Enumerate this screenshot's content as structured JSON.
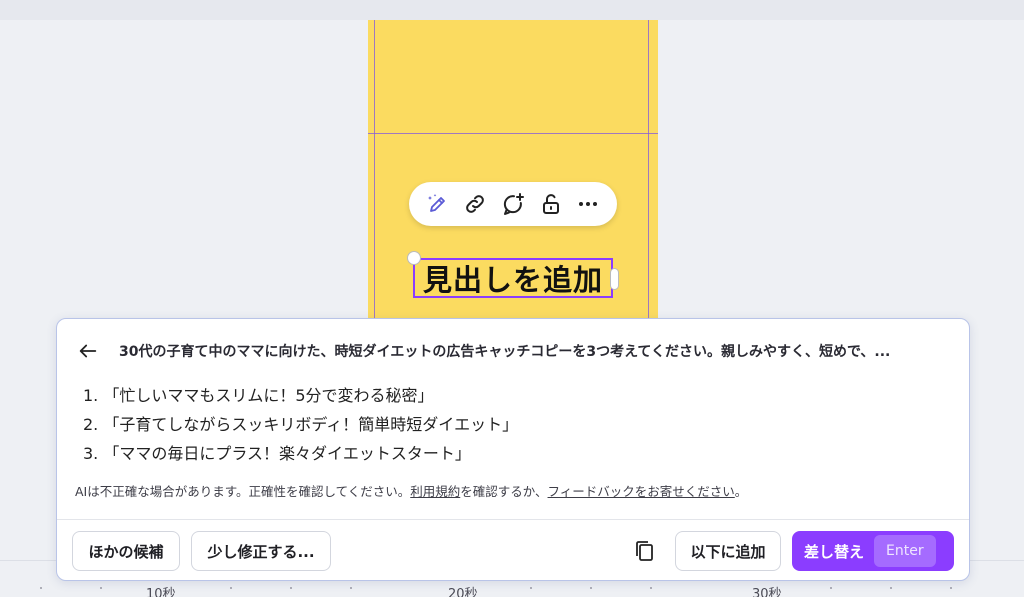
{
  "canvas": {
    "background_color": "#fbdb60",
    "guide_color": "#8a5fd6",
    "heading_text": "見出しを追加"
  },
  "floating_toolbar": {
    "items": [
      {
        "icon": "magic-pencil-icon"
      },
      {
        "icon": "link-icon"
      },
      {
        "icon": "add-comment-icon"
      },
      {
        "icon": "lock-icon"
      },
      {
        "icon": "more-icon"
      }
    ]
  },
  "ai_panel": {
    "back_icon": "arrow-left-icon",
    "prompt": "30代の子育て中のママに向けた、時短ダイエットの広告キャッチコピーを3つ考えてください。親しみやすく、短めで、...",
    "results": [
      "1. 「忙しいママもスリムに！5分で変わる秘密」",
      "2. 「子育てしながらスッキリボディ！簡単時短ダイエット」",
      "3. 「ママの毎日にプラス！楽々ダイエットスタート」"
    ],
    "disclaimer": {
      "text1": "AIは不正確な場合があります。正確性を確認してください。",
      "link1": "利用規約",
      "text2": "を確認するか、",
      "link2": "フィードバックをお寄せください",
      "text3": "。"
    },
    "buttons": {
      "other_candidates": "ほかの候補",
      "modify": "少し修正する...",
      "copy_icon": "copy-icon",
      "add_below": "以下に追加",
      "replace": "差し替え",
      "replace_shortcut": "Enter"
    },
    "accent_color": "#8b3dff"
  },
  "timeline": {
    "labels": [
      "10秒",
      "20秒",
      "30秒"
    ]
  }
}
